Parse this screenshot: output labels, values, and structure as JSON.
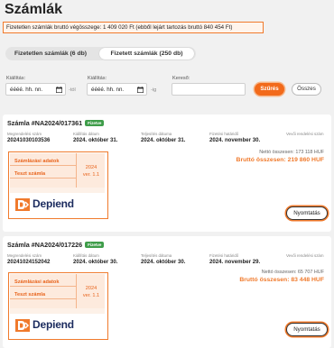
{
  "page": {
    "title": "Számlák"
  },
  "notice": {
    "text": "Fizetetlen számlák bruttó végösszege: 1 409 020 Ft (ebből lejárt tartozás bruttó 840 454 Ft)"
  },
  "tabs": [
    {
      "label": "Fizetetlen számlák (6 db)",
      "active": false
    },
    {
      "label": "Fizetett számlák (250 db)",
      "active": true
    }
  ],
  "filters": {
    "from_label": "Kiállítás:",
    "to_label": "Kiállítás:",
    "from_placeholder": "éééé. hh. nn.",
    "to_placeholder": "éééé. hh. nn.",
    "from_suffix": "-tól",
    "to_suffix": "-ig",
    "search_label": "Kereső:",
    "search_value": "",
    "filter_button": "Szűrés",
    "all_button": "Összes"
  },
  "meta_labels": {
    "order_number": "Megrendelési szám",
    "issue_date": "Kiállítás dátum",
    "fulfillment_date": "Teljesítés dátuma",
    "payment_deadline": "Fizetési határidő",
    "customer_order_number": "Vevői rendelési szám"
  },
  "invoices": [
    {
      "title": "Számla #NA2024/017361",
      "status": "Fizetve",
      "status_color": "#3f9d4a",
      "order_number": "20241030103536",
      "issue_date": "2024. október 31.",
      "fulfillment_date": "2024. október 31.",
      "payment_deadline": "2024. november 30.",
      "customer_order_number": "",
      "net_text": "Nettó összesen: 173 118 HUF",
      "gross_text": "Bruttó összesen: 219 860 HUF",
      "preview": {
        "line1": "Számlázási adatok",
        "line2": "Teszt számla",
        "year": "2024",
        "version": "ver. 1.1",
        "logo_text": "Depiend"
      },
      "print_label": "Nyomtatás"
    },
    {
      "title": "Számla #NA2024/017226",
      "status": "Fizetve",
      "status_color": "#3f9d4a",
      "order_number": "20241024152042",
      "issue_date": "2024. október 30.",
      "fulfillment_date": "2024. október 30.",
      "payment_deadline": "2024. november 29.",
      "customer_order_number": "",
      "net_text": "Nettó összesen: 65 707 HUF",
      "gross_text": "Bruttó összesen: 83 448 HUF",
      "preview": {
        "line1": "Számlázási adatok",
        "line2": "Teszt számla",
        "year": "2024",
        "version": "ver. 1.1",
        "logo_text": "Depiend"
      },
      "print_label": "Nyomtatás"
    }
  ],
  "colors": {
    "accent": "#f07a2c",
    "brand_dark": "#1b2b5e",
    "paid_badge": "#3f9d4a"
  }
}
